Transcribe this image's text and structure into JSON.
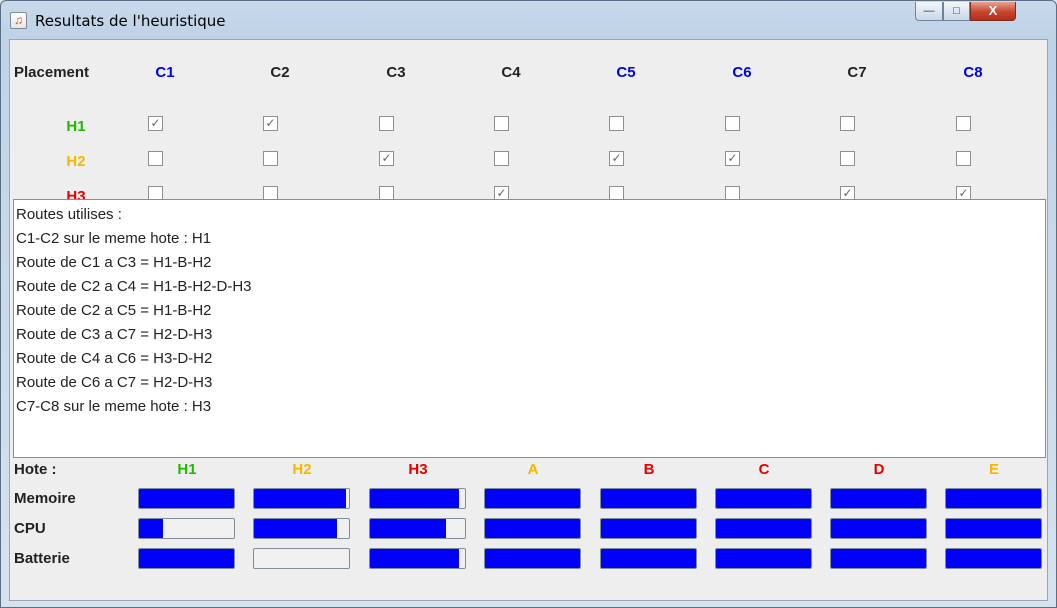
{
  "window": {
    "title": "Resultats de l'heuristique",
    "icon": "java-icon",
    "controls": {
      "minimize": "—",
      "maximize": "□",
      "close": "X"
    }
  },
  "placement": {
    "label": "Placement",
    "columns": [
      {
        "label": "C1",
        "color": "#0000e6"
      },
      {
        "label": "C2",
        "color": "#222222"
      },
      {
        "label": "C3",
        "color": "#222222"
      },
      {
        "label": "C4",
        "color": "#222222"
      },
      {
        "label": "C5",
        "color": "#0000e6"
      },
      {
        "label": "C6",
        "color": "#0000e6"
      },
      {
        "label": "C7",
        "color": "#222222"
      },
      {
        "label": "C8",
        "color": "#0000e6"
      }
    ],
    "rows": [
      {
        "label": "H1",
        "color": "#22b800",
        "checked": [
          true,
          true,
          false,
          false,
          false,
          false,
          false,
          false
        ]
      },
      {
        "label": "H2",
        "color": "#f5b800",
        "checked": [
          false,
          false,
          true,
          false,
          true,
          true,
          false,
          false
        ]
      },
      {
        "label": "H3",
        "color": "#e60000",
        "checked": [
          false,
          false,
          false,
          true,
          false,
          false,
          true,
          true
        ]
      }
    ]
  },
  "routes": {
    "lines": [
      "Routes utilises :",
      "C1-C2 sur le meme hote : H1",
      "Route de C1 a C3 = H1-B-H2",
      "Route de C2 a C4 = H1-B-H2-D-H3",
      "Route de C2 a C5 = H1-B-H2",
      "Route de C3 a C7 = H2-D-H3",
      "Route de C4 a C6 = H3-D-H2",
      "Route de C6 a C7 = H2-D-H3",
      "C7-C8 sur le meme hote : H3"
    ]
  },
  "resources": {
    "host_label": "Hote :",
    "metrics": [
      "Memoire",
      "CPU",
      "Batterie"
    ],
    "hosts": [
      {
        "label": "H1",
        "color": "#22b800",
        "levels": [
          1.0,
          0.25,
          1.0
        ]
      },
      {
        "label": "H2",
        "color": "#f5b800",
        "levels": [
          0.97,
          0.87,
          0.0
        ]
      },
      {
        "label": "H3",
        "color": "#e60000",
        "levels": [
          0.94,
          0.8,
          0.94
        ]
      },
      {
        "label": "A",
        "color": "#f5b800",
        "levels": [
          1.0,
          1.0,
          1.0
        ]
      },
      {
        "label": "B",
        "color": "#e60000",
        "levels": [
          1.0,
          1.0,
          1.0
        ]
      },
      {
        "label": "C",
        "color": "#e60000",
        "levels": [
          1.0,
          1.0,
          1.0
        ]
      },
      {
        "label": "D",
        "color": "#e60000",
        "levels": [
          1.0,
          1.0,
          1.0
        ]
      },
      {
        "label": "E",
        "color": "#f5b800",
        "levels": [
          1.0,
          1.0,
          1.0
        ]
      }
    ]
  }
}
